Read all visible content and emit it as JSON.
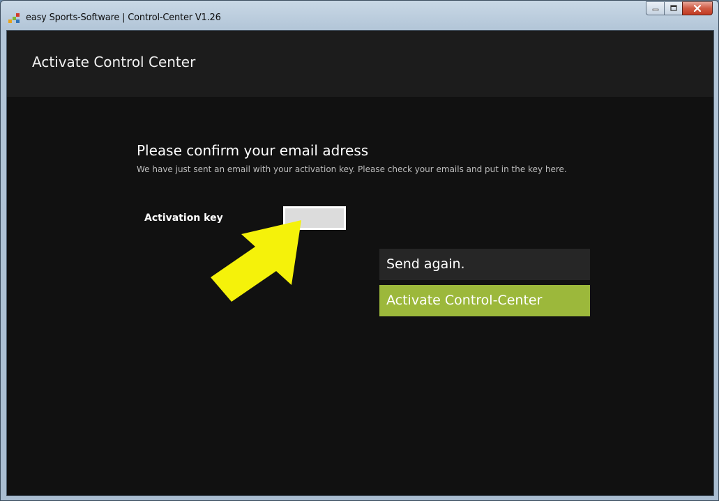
{
  "window": {
    "title": "easy Sports-Software | Control-Center V1.26"
  },
  "header": {
    "title": "Activate Control Center"
  },
  "main": {
    "heading": "Please confirm your email adress",
    "description": "We have just sent an email with your activation key. Please check your emails and put in the key here.",
    "activation_key_label": "Activation key",
    "activation_key_value": ""
  },
  "buttons": {
    "send_again": "Send again.",
    "activate": "Activate Control-Center"
  },
  "colors": {
    "accent_green": "#9cb83b",
    "arrow_yellow": "#f5f20a",
    "background": "#111111"
  },
  "icons": {
    "app": "easy-sports-logo-icon",
    "annotation": "yellow-arrow-icon"
  }
}
